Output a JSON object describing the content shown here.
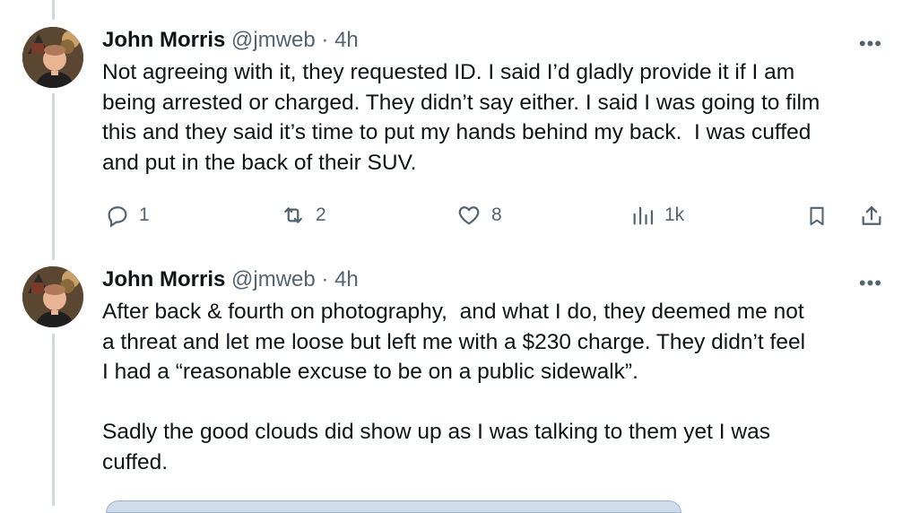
{
  "tweets": [
    {
      "name": "John Morris",
      "handle": "@jmweb",
      "separator": "·",
      "time": "4h",
      "more_label": "•••",
      "text": "Not agreeing with it, they requested ID. I said I’d gladly provide it if I am\nbeing arrested or charged. They didn’t say either. I said I was going to film\nthis and they said it’s time to put my hands behind my back.  I was cuffed\nand put in the back of their SUV.",
      "replies": "1",
      "reposts": "2",
      "likes": "8",
      "views": "1k"
    },
    {
      "name": "John Morris",
      "handle": "@jmweb",
      "separator": "·",
      "time": "4h",
      "more_label": "•••",
      "text": "After back & fourth on photography,  and what I do, they deemed me not\na threat and let me loose but left me with a $230 charge. They didn’t feel\nI had a “reasonable excuse to be on a public sidewalk”.\n\nSadly the good clouds did show up as I was talking to them yet I was\ncuffed."
    }
  ],
  "icons": {
    "reply": "reply-icon",
    "repost": "repost-icon",
    "like": "like-icon",
    "views": "views-icon",
    "bookmark": "bookmark-icon",
    "share": "share-icon",
    "more": "more-icon"
  },
  "colors": {
    "text": "#0f1419",
    "secondary": "#536471",
    "thread_line": "#cfd9de"
  }
}
